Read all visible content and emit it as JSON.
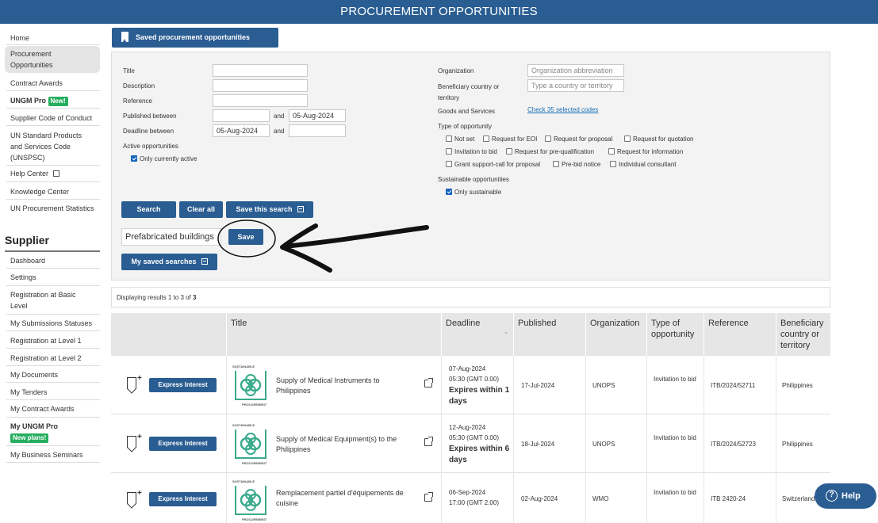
{
  "header": {
    "title": "PROCUREMENT OPPORTUNITIES"
  },
  "sidebar": {
    "items": [
      {
        "label": "Home"
      },
      {
        "label": "Procurement Opportunities"
      },
      {
        "label": "Contract Awards"
      },
      {
        "label": "UNGM Pro",
        "badge": "New!"
      },
      {
        "label": "Supplier Code of Conduct"
      },
      {
        "label": "UN Standard Products and Services Code (UNSPSC)"
      },
      {
        "label": "Help Center"
      },
      {
        "label": "Knowledge Center"
      },
      {
        "label": "UN Procurement Statistics"
      }
    ],
    "supplier_heading": "Supplier",
    "supplier_items": [
      {
        "label": "Dashboard"
      },
      {
        "label": "Settings"
      },
      {
        "label": "Registration at Basic Level"
      },
      {
        "label": "My Submissions Statuses"
      },
      {
        "label": "Registration at Level 1"
      },
      {
        "label": "Registration at Level 2"
      },
      {
        "label": "My Documents"
      },
      {
        "label": "My Tenders"
      },
      {
        "label": "My Contract Awards"
      },
      {
        "label": "My UNGM Pro",
        "badge": "New plans!"
      },
      {
        "label": "My Business Seminars"
      }
    ]
  },
  "saved_button": {
    "label": "Saved procurement opportunities"
  },
  "filters": {
    "title_label": "Title",
    "description_label": "Description",
    "reference_label": "Reference",
    "published_label": "Published between",
    "published_and": "and",
    "published_to": "05-Aug-2024",
    "deadline_label": "Deadline between",
    "deadline_from": "05-Aug-2024",
    "deadline_and": "and",
    "active_label": "Active opportunities",
    "only_active_label": "Only currently active",
    "organization_label": "Organization",
    "organization_placeholder": "Organization abbreviation",
    "beneficiary_label": "Beneficiary country or territory",
    "beneficiary_placeholder": "Type a country or territory",
    "goods_label": "Goods and Services",
    "goods_link": "Check 35 selected codes",
    "type_label": "Type of opportunity",
    "types": [
      "Not set",
      "Request for EOI",
      "Request for proposal",
      "Request for quotation",
      "Invitation to bid",
      "Request for pre-qualification",
      "Request for information",
      "Grant support-call for proposal",
      "Pre-bid notice",
      "Individual consultant"
    ],
    "sustainable_label": "Sustainable opportunities",
    "only_sustainable_label": "Only sustainable"
  },
  "actions": {
    "search": "Search",
    "clear_all": "Clear all",
    "save_search": "Save this search",
    "search_name_value": "Prefabricated buildings",
    "save": "Save",
    "my_saved_searches": "My saved searches"
  },
  "results": {
    "prefix": "Displaying results 1 to 3 of ",
    "total": "3"
  },
  "table": {
    "headers": {
      "title": "Title",
      "deadline": "Deadline",
      "published": "Published",
      "organization": "Organization",
      "type": "Type of opportunity",
      "reference": "Reference",
      "beneficiary": "Beneficiary country or territory"
    },
    "express_label": "Express Interest",
    "logo_top": "SUSTAINABLE",
    "logo_bottom": "PROCUREMENT",
    "rows": [
      {
        "title": "Supply of Medical Instruments to Philippines",
        "deadline_date": "07-Aug-2024",
        "deadline_time": "05:30 (GMT 0.00)",
        "expires": "Expires within 1 days",
        "published": "17-Jul-2024",
        "organization": "UNOPS",
        "type": "Invitation to bid",
        "reference": "ITB/2024/52711",
        "beneficiary": "Philippines"
      },
      {
        "title": "Supply of Medical Equipment(s) to the Philippines",
        "deadline_date": "12-Aug-2024",
        "deadline_time": "05:30 (GMT 0.00)",
        "expires": "Expires within 6 days",
        "published": "18-Jul-2024",
        "organization": "UNOPS",
        "type": "Invitation to bid",
        "reference": "ITB/2024/52723",
        "beneficiary": "Philippines"
      },
      {
        "title": "Remplacement partiel d'équipements de cuisine",
        "deadline_date": "06-Sep-2024",
        "deadline_time": "17:00 (GMT 2.00)",
        "expires": "",
        "published": "02-Aug-2024",
        "organization": "WMO",
        "type": "Invitation to bid",
        "reference": "ITB 2420-24",
        "beneficiary": "Switzerland"
      }
    ]
  },
  "help": {
    "label": "Help"
  },
  "colors": {
    "primary": "#2a5d92",
    "badge_green": "#27ae60",
    "sustainable_green": "#3aaa8c"
  }
}
